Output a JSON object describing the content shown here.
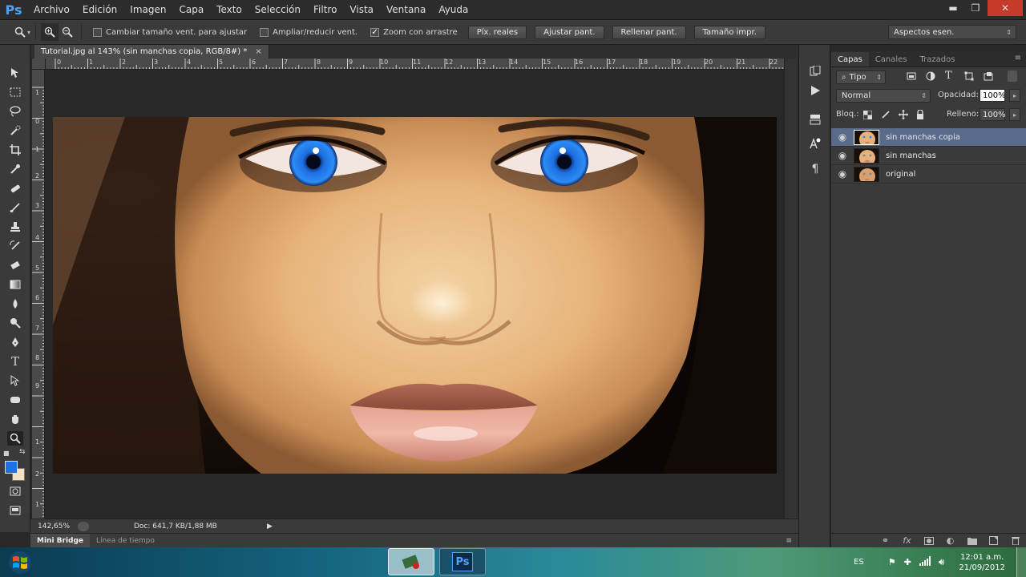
{
  "app": {
    "logo": "Ps",
    "menu": [
      "Archivo",
      "Edición",
      "Imagen",
      "Capa",
      "Texto",
      "Selección",
      "Filtro",
      "Vista",
      "Ventana",
      "Ayuda"
    ],
    "window_controls": {
      "minimize": "▬",
      "restore": "❐",
      "close": "✕"
    }
  },
  "options_bar": {
    "checkboxes": [
      {
        "label": "Cambiar tamaño vent. para ajustar",
        "checked": false
      },
      {
        "label": "Ampliar/reducir vent.",
        "checked": false
      },
      {
        "label": "Zoom con arrastre",
        "checked": true
      }
    ],
    "buttons": [
      "Píx. reales",
      "Ajustar pant.",
      "Rellenar pant.",
      "Tamaño impr."
    ],
    "workspace": "Aspectos esen."
  },
  "document": {
    "tab_title": "Tutorial.jpg al 143% (sin manchas copia, RGB/8#) *",
    "tab_close": "×",
    "ruler_h": [
      "0",
      "1",
      "2",
      "3",
      "4",
      "5",
      "6",
      "7",
      "8",
      "9",
      "10",
      "11",
      "12",
      "13",
      "14",
      "15",
      "16",
      "17",
      "18",
      "19",
      "20",
      "21",
      "22"
    ],
    "ruler_v": [
      "1",
      "0",
      "1",
      "2",
      "3",
      "4",
      "5",
      "6",
      "7",
      "8",
      "9",
      "1",
      "2",
      "1"
    ]
  },
  "status": {
    "zoom": "142,65%",
    "doc": "Doc: 641,7 KB/1,88 MB",
    "arrow": "▶"
  },
  "mini_bridge": {
    "tabs": [
      "Mini Bridge",
      "Línea de tiempo"
    ],
    "menu_icon": "≡"
  },
  "layers_panel": {
    "tabs": [
      "Capas",
      "Canales",
      "Trazados"
    ],
    "filter": "Tipo",
    "blend_mode": "Normal",
    "opacity_label": "Opacidad:",
    "opacity_value": "100%",
    "lock_label": "Bloq.:",
    "fill_label": "Relleno:",
    "fill_value": "100%",
    "layers": [
      {
        "name": "sin manchas copia",
        "selected": true
      },
      {
        "name": "sin manchas",
        "selected": false
      },
      {
        "name": "original",
        "selected": false
      }
    ]
  },
  "taskbar": {
    "lang": "ES",
    "time": "12:01 a.m.",
    "date": "21/09/2012",
    "ps_label": "Ps"
  },
  "colors": {
    "foreground": "#1f6fe6",
    "background": "#f4e2c4",
    "accent": "#4fa3ff"
  }
}
